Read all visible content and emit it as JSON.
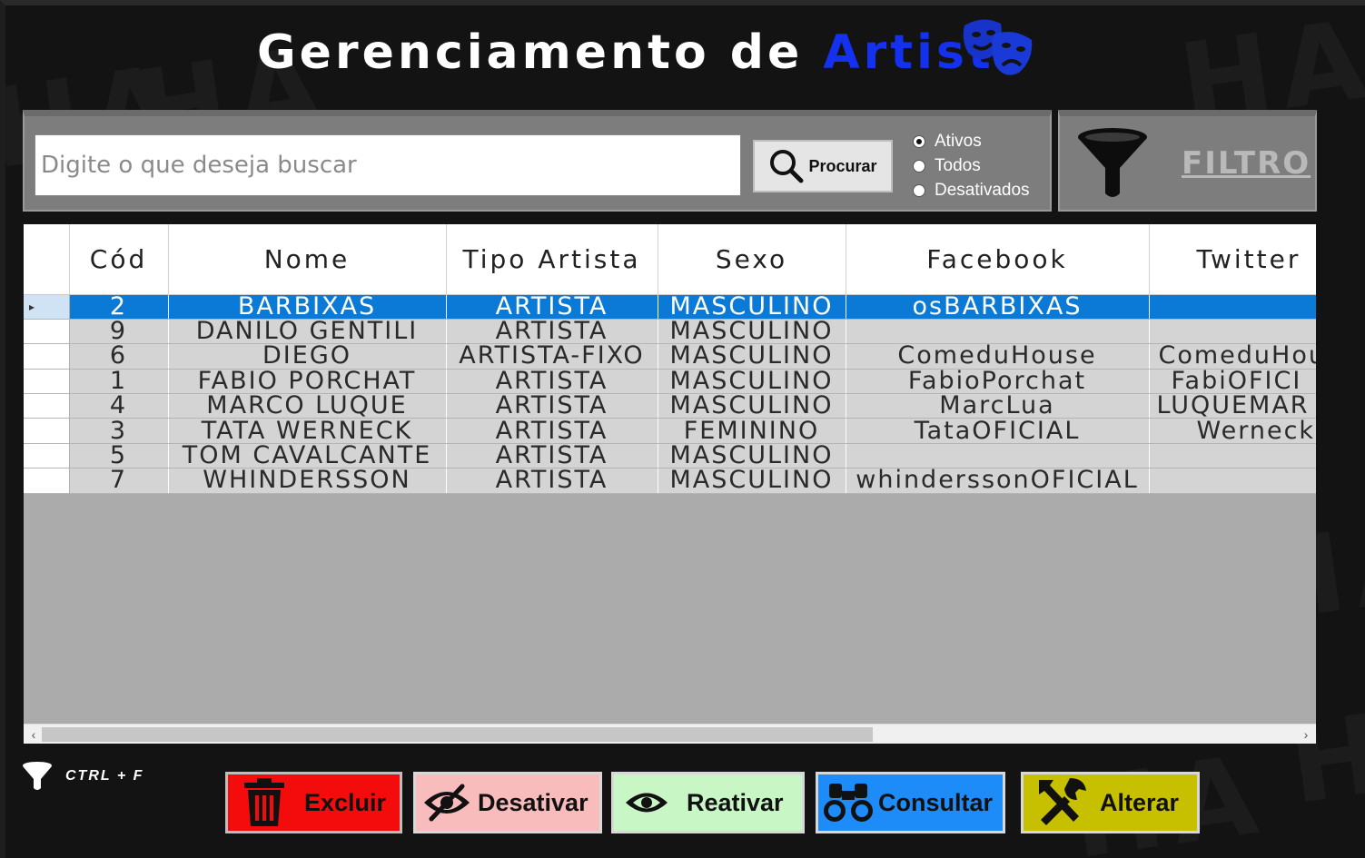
{
  "header": {
    "title_main": "Gerenciamento de ",
    "title_accent": "Artista"
  },
  "search": {
    "placeholder": "Digite o que deseja buscar",
    "button_label": "Procurar",
    "status_options": [
      "Ativos",
      "Todos",
      "Desativados"
    ],
    "selected_status": "Ativos"
  },
  "filter": {
    "label": "FILTRO"
  },
  "grid": {
    "columns": [
      "Cód",
      "Nome",
      "Tipo Artista",
      "Sexo",
      "Facebook",
      "Twitter"
    ],
    "rows": [
      {
        "cod": "2",
        "nome": "BARBIXAS",
        "tipo": "ARTISTA",
        "sexo": "MASCULINO",
        "facebook": "osBARBIXAS",
        "twitter": ""
      },
      {
        "cod": "9",
        "nome": "DANILO GENTILI",
        "tipo": "ARTISTA",
        "sexo": "MASCULINO",
        "facebook": "",
        "twitter": ""
      },
      {
        "cod": "6",
        "nome": "DIEGO",
        "tipo": "ARTISTA-FIXO",
        "sexo": "MASCULINO",
        "facebook": "ComeduHouse",
        "twitter": "ComeduHou"
      },
      {
        "cod": "1",
        "nome": "FABIO PORCHAT",
        "tipo": "ARTISTA",
        "sexo": "MASCULINO",
        "facebook": "FabioPorchat",
        "twitter": "FabiOFICI"
      },
      {
        "cod": "4",
        "nome": "MARCO LUQUE",
        "tipo": "ARTISTA",
        "sexo": "MASCULINO",
        "facebook": "MarcLua",
        "twitter": "LUQUEMAR"
      },
      {
        "cod": "3",
        "nome": "TATA WERNECK",
        "tipo": "ARTISTA",
        "sexo": "FEMININO",
        "facebook": "TataOFICIAL",
        "twitter": "Werneck"
      },
      {
        "cod": "5",
        "nome": "TOM CAVALCANTE",
        "tipo": "ARTISTA",
        "sexo": "MASCULINO",
        "facebook": "",
        "twitter": ""
      },
      {
        "cod": "7",
        "nome": "WHINDERSSON",
        "tipo": "ARTISTA",
        "sexo": "MASCULINO",
        "facebook": "whinderssonOFICIAL",
        "twitter": ""
      }
    ],
    "selected_row": 0
  },
  "shortcut": {
    "text": "CTRL + F"
  },
  "actions": {
    "excluir": "Excluir",
    "desativar": "Desativar",
    "reativar": "Reativar",
    "consultar": "Consultar",
    "alterar": "Alterar"
  },
  "colors": {
    "accent": "#1431f0",
    "selection": "#0a7ad6",
    "excluir": "#f40b0b",
    "desativar": "#f9bcbc",
    "reativar": "#c8f7c5",
    "consultar": "#1d8cf8",
    "alterar": "#c7c000"
  }
}
